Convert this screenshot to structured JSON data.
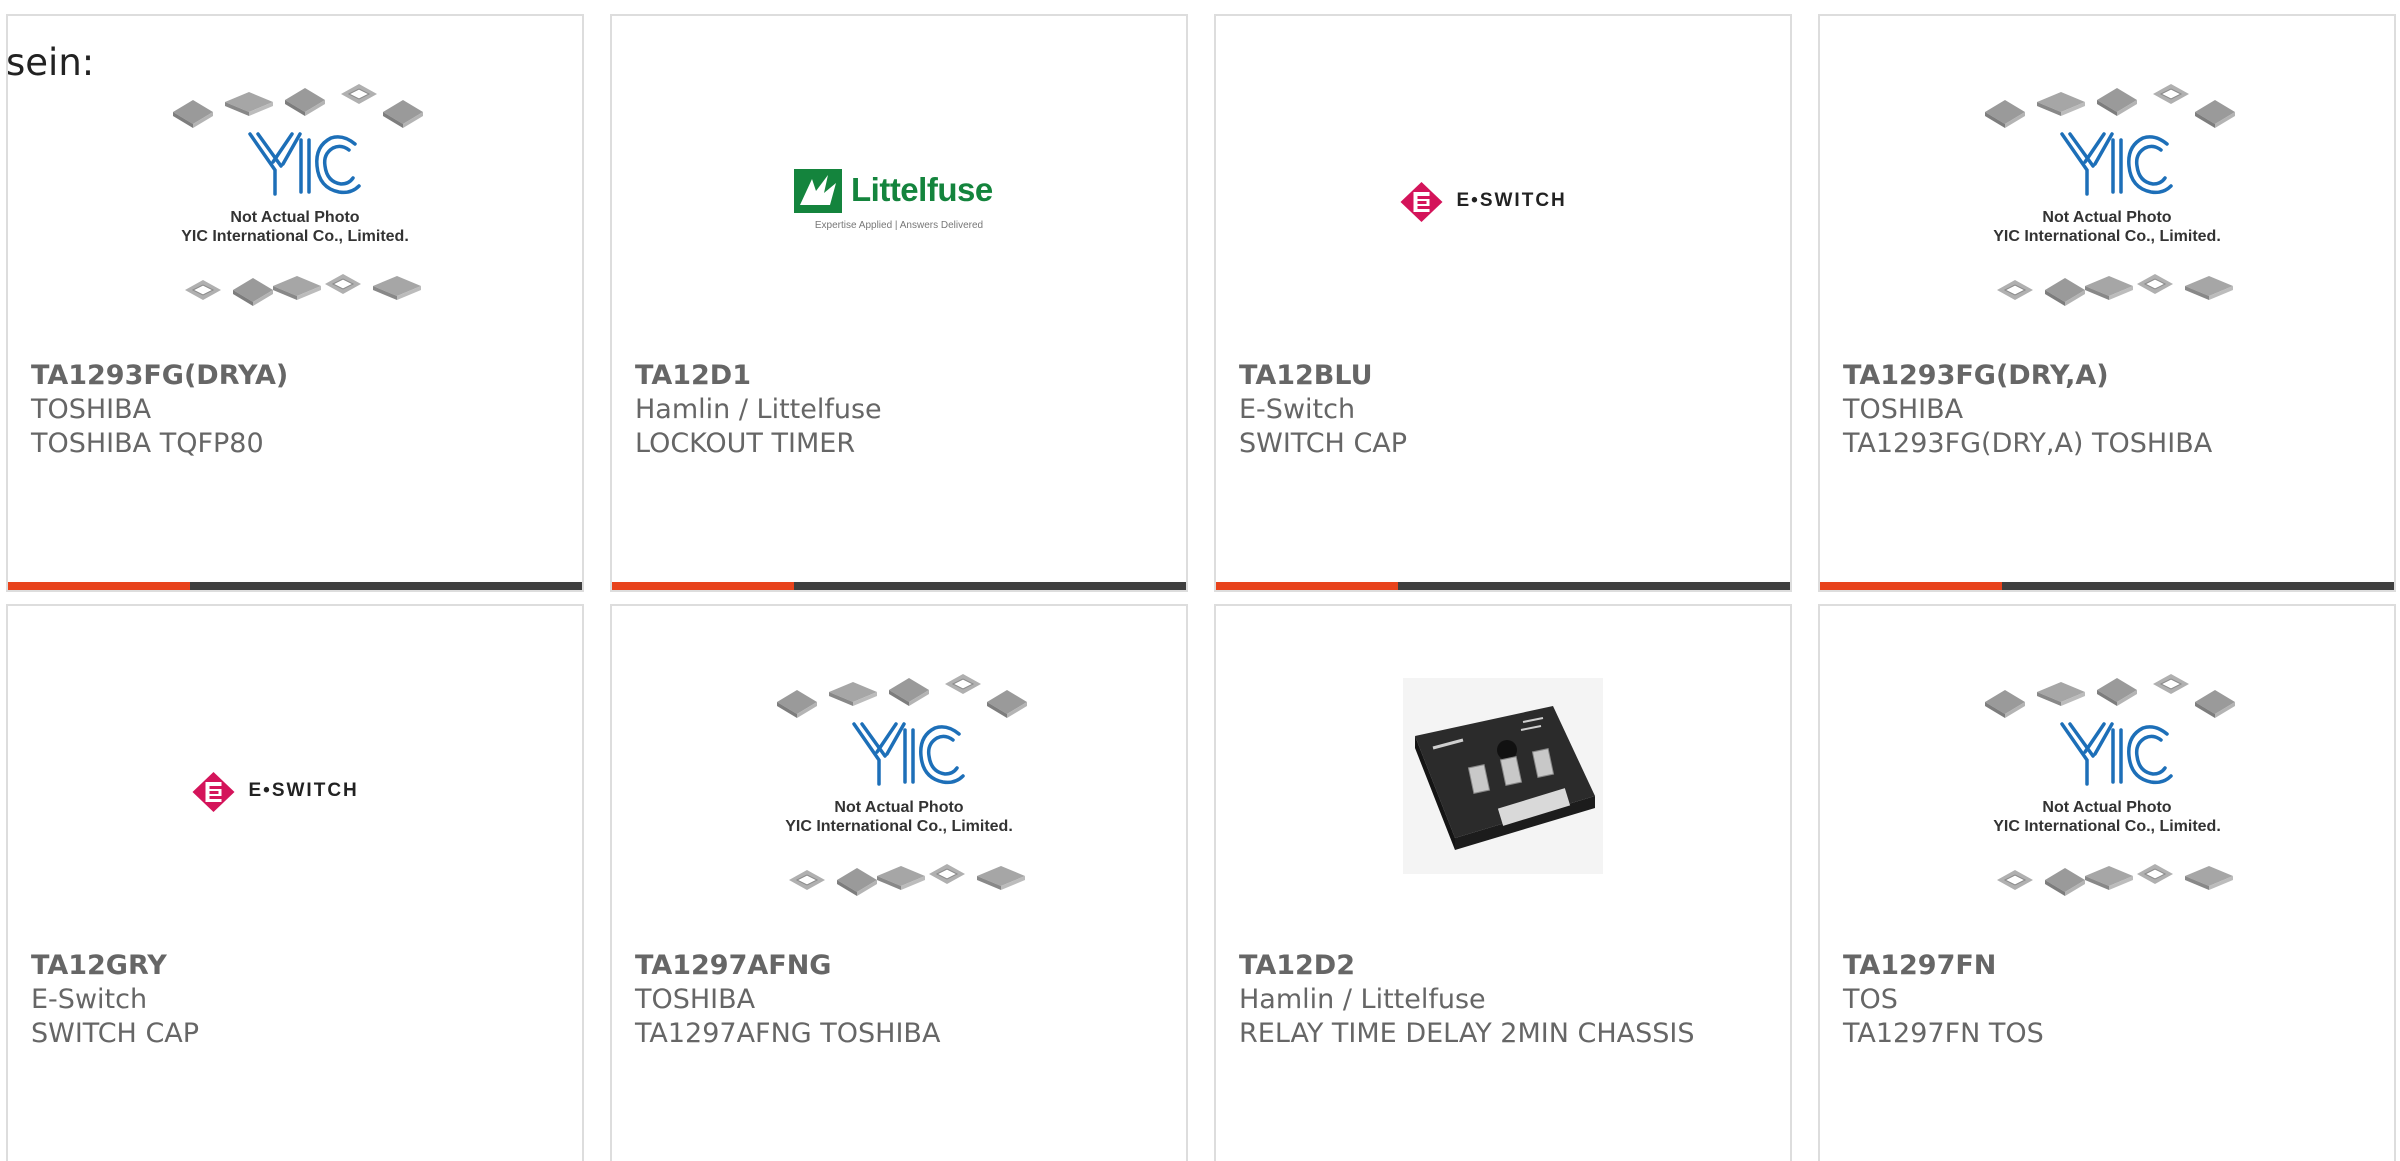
{
  "intro_text": "sein:",
  "placeholder": {
    "line1": "Not Actual Photo",
    "line2": "YIC International Co., Limited."
  },
  "logos": {
    "littelfuse_word": "Littelfuse",
    "littelfuse_tagline": "Expertise Applied | Answers Delivered",
    "eswitch_word": "E•SWITCH"
  },
  "colors": {
    "accent": "#e8431c",
    "bar": "#3f3f3f",
    "text": "#666666",
    "border": "#dddddd",
    "eswitch_mark": "#d4145a",
    "littelfuse_green": "#14843d"
  },
  "products": [
    {
      "part": "TA1293FG(DRYA)",
      "manufacturer": "TOSHIBA",
      "description": "TOSHIBA TQFP80",
      "image": "yic-placeholder"
    },
    {
      "part": "TA12D1",
      "manufacturer": "Hamlin / Littelfuse",
      "description": "LOCKOUT TIMER",
      "image": "littelfuse-logo"
    },
    {
      "part": "TA12BLU",
      "manufacturer": "E-Switch",
      "description": "SWITCH CAP",
      "image": "eswitch-logo"
    },
    {
      "part": "TA1293FG(DRY,A)",
      "manufacturer": "TOSHIBA",
      "description": "TA1293FG(DRY,A) TOSHIBA",
      "image": "yic-placeholder"
    },
    {
      "part": "TA12GRY",
      "manufacturer": "E-Switch",
      "description": "SWITCH CAP",
      "image": "eswitch-logo"
    },
    {
      "part": "TA1297AFNG",
      "manufacturer": "TOSHIBA",
      "description": "TA1297AFNG TOSHIBA",
      "image": "yic-placeholder"
    },
    {
      "part": "TA12D2",
      "manufacturer": "Hamlin / Littelfuse",
      "description": "RELAY TIME DELAY 2MIN CHASSIS",
      "image": "relay-photo"
    },
    {
      "part": "TA1297FN",
      "manufacturer": "TOS",
      "description": "TA1297FN TOS",
      "image": "yic-placeholder"
    }
  ]
}
